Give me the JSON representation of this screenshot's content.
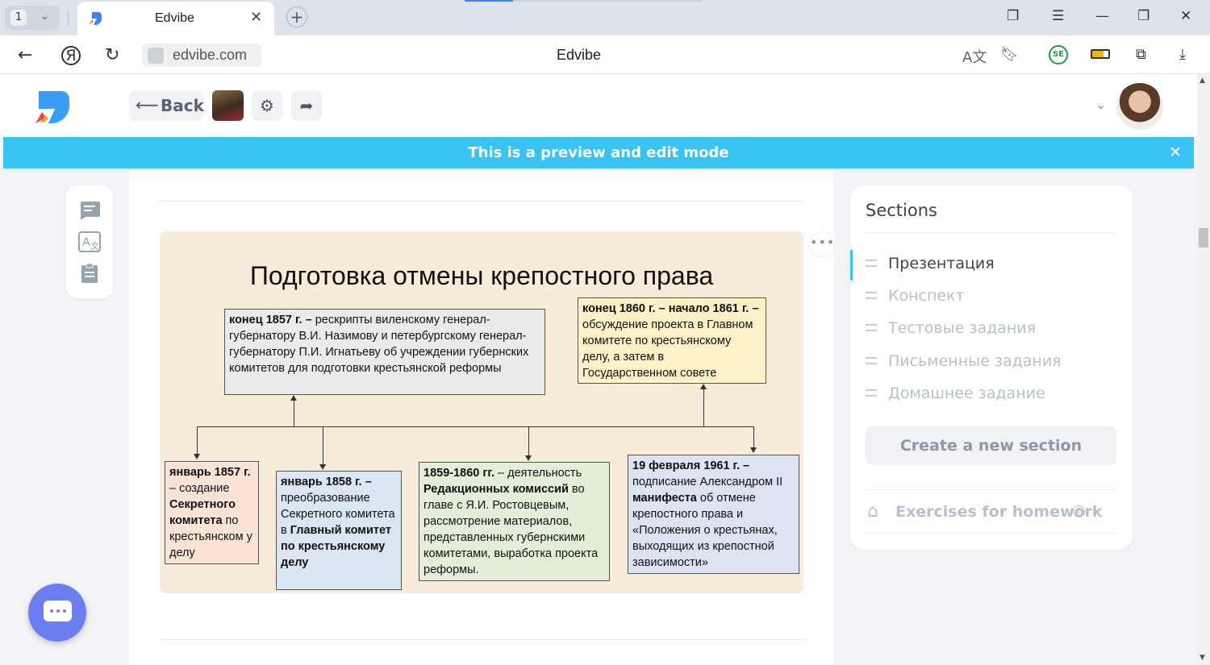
{
  "browser": {
    "tab_count": "1",
    "tab_title": "Edvibe",
    "url": "edvibe.com",
    "page_title": "Edvibe",
    "extension_badge": "SE"
  },
  "header": {
    "back_label": "Back"
  },
  "banner": {
    "text": "This is a preview and edit mode"
  },
  "slide": {
    "title": "Подготовка отмены крепостного права",
    "boxes": {
      "b1_date": "конец 1857 г. –",
      "b1_text": " рескрипты виленскому генерал-губернатору В.И. Назимову и петербургскому генерал-губернатору П.И. Игнатьеву об учреждении губернских комитетов для подготовки крестьянской реформы",
      "b2_date": "конец 1860 г. – начало 1861 г. –",
      "b2_text": " обсуждение проекта в Главном комитете по крестьянскому делу, а затем в Государственном совете",
      "b3_date": "январь 1857 г.",
      "b3_text1": " – создание ",
      "b3_bold": "Секретного комитета",
      "b3_text2": " по крестьянском у делу",
      "b4_date": "январь 1858 г. –",
      "b4_text1": " преобразование Секретного комитета в ",
      "b4_bold": "Главный комитет по крестьянскому делу",
      "b5_date": "1859-1860 гг.",
      "b5_text1": " – деятельность ",
      "b5_bold": "Редакционных комиссий",
      "b5_text2": " во главе с Я.И. Ростовцевым, рассмотрение материалов, представленных губернскими комитетами, выработка проекта реформы.",
      "b6_date": "19 февраля 1961 г. –",
      "b6_text1": " подписание Александром II ",
      "b6_bold": "манифеста",
      "b6_text2": " об отмене крепостного права и «Положения о крестьянах, выходящих из крепостной зависимости»"
    }
  },
  "sections": {
    "title": "Sections",
    "items": [
      {
        "label": "Презентация",
        "active": true
      },
      {
        "label": "Конспект",
        "active": false
      },
      {
        "label": "Тестовые задания",
        "active": false
      },
      {
        "label": "Письменные задания",
        "active": false
      },
      {
        "label": "Домашнее задание",
        "active": false
      }
    ],
    "create_label": "Create a new section",
    "homework_label": "Exercises for homework"
  },
  "colors": {
    "accent": "#38c3f3",
    "chat": "#6c7ff0",
    "slide_bg": "#f7ecd9",
    "box_grey": "#ebebeb",
    "box_yellow": "#fdf1c7",
    "box_pink": "#fbe3d6",
    "box_blue": "#dae6f3",
    "box_green": "#e2efd9",
    "box_lavender": "#dce3f3"
  },
  "icons": [
    "back-icon",
    "yandex-icon",
    "reload-icon",
    "lock-icon",
    "translate-icon",
    "bookmark-icon",
    "battery-icon",
    "extensions-icon",
    "download-icon",
    "gear-icon",
    "share-icon",
    "chat-icon",
    "notes-icon",
    "clipboard-icon",
    "house-icon",
    "help-icon"
  ]
}
